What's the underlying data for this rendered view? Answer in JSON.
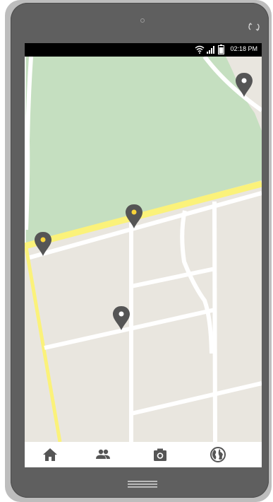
{
  "status_bar": {
    "time": "02:18 PM",
    "icons": [
      "wifi-icon",
      "signal-icon",
      "battery-icon"
    ]
  },
  "device": {
    "icons": [
      "speaker-icon",
      "rotate-icon",
      "home-button-icon"
    ]
  },
  "map": {
    "colors": {
      "land": "#e9e6df",
      "park": "#c5dfc0",
      "road": "#ffffff",
      "highway": "#fbf27a",
      "pin": "#555555",
      "pin_highlight": "#f8d43a"
    },
    "markers": [
      "map-pin-top-right",
      "map-pin-center",
      "map-pin-left",
      "map-pin-lower"
    ]
  },
  "bottom_nav": {
    "items": [
      {
        "icon": "home-icon"
      },
      {
        "icon": "people-icon"
      },
      {
        "icon": "camera-icon"
      },
      {
        "icon": "globe-icon"
      }
    ]
  }
}
